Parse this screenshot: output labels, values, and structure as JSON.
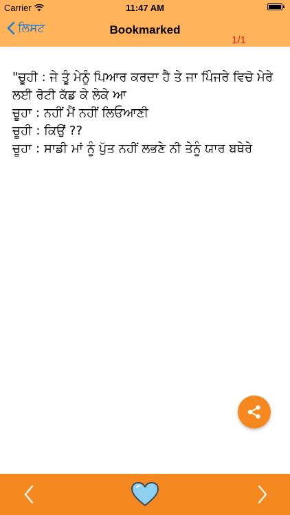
{
  "status_bar": {
    "carrier": "Carrier",
    "time": "11:47 AM",
    "wifi_icon": "wifi-icon",
    "battery_icon": "battery-icon"
  },
  "nav": {
    "back_label": "ਲਿਸਟ",
    "back_icon": "chevron-left-icon",
    "title": "Bookmarked",
    "page_counter": "1/1"
  },
  "content": {
    "lines": [
      "\"ਚੂਹੀ : ਜੇ ਤੂੰ ਮੇਨੂੰ ਪਿਆਰ ਕਰਦਾ ਹੈ ਤੇ ਜਾ ਪਿੰਜਰੇ ਵਿਚੋ ਮੇਰੇ ਲਈ ਰੋਟੀ ਕੱਡ ਕੇ ਲੇਕੇ ਆ",
      "ਚੂਹਾ : ਨਹੀਂ ਮੈਂ ਨਹੀਂ ਲਿਓਆਣੀ",
      "ਚੂਹੀ : ਕਿਉਂ ??",
      "ਚੂਹਾ : ਸਾਡੀ ਮਾਂ ਨੂੰ ਪੁੱਤ ਨਹੀਂ ਲਭਣੇ ਨੀ ਤੇਨੂੰ ਯਾਰ ਬਥੇਰੇ"
    ]
  },
  "share_button": {
    "icon": "share-icon"
  },
  "toolbar": {
    "prev_icon": "chevron-left-icon",
    "favorite_icon": "heart-icon",
    "next_icon": "chevron-right-icon"
  },
  "colors": {
    "header_bg": "#ffb35a",
    "toolbar_bg": "#f5891f",
    "back_link": "#1a7ad9",
    "counter": "#e8231c",
    "heart_fill": "#8fd0f0"
  }
}
